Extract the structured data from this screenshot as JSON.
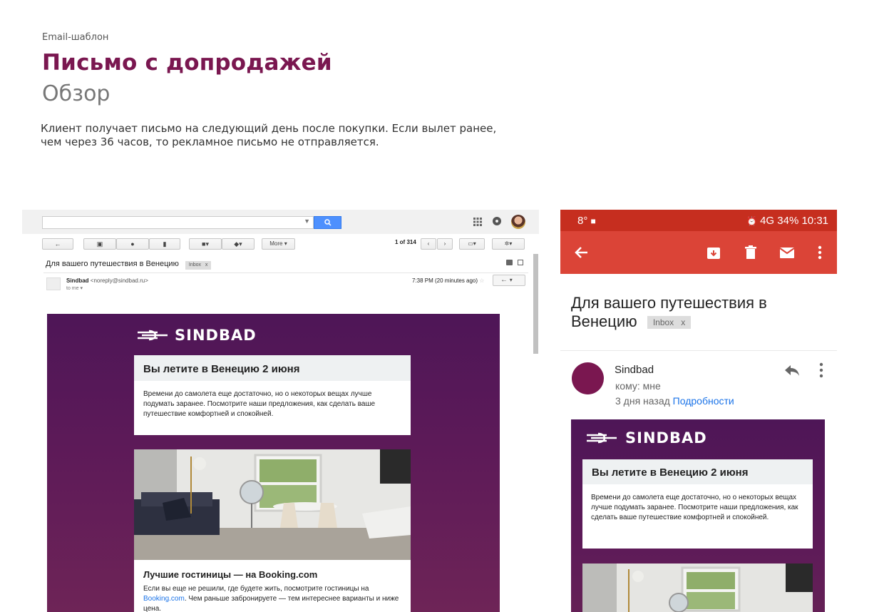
{
  "header": {
    "eyebrow": "Email-шаблон",
    "title": "Письмо с допродажей",
    "subtitle": "Обзор",
    "description": "Клиент получает письмо на следующий день после покупки. Если вылет ранее, чем через 36 часов, то рекламное письмо не отправляется."
  },
  "desktop": {
    "toolbar": {
      "more_label": "More",
      "pager": "1 of 314"
    },
    "subject": "Для вашего путешествия в Венецию",
    "tag": "Inbox",
    "tag_close": "x",
    "sender_name": "Sindbad",
    "sender_email": "<noreply@sindbad.ru>",
    "to_me": "to me",
    "time": "7:38 PM (20 minutes ago)"
  },
  "email": {
    "logo_text": "SINDBAD",
    "card1_title": "Вы летите в Венецию 2 июня",
    "card1_body": "Времени до самолета еще достаточно, но о некоторых вещах лучше подумать заранее. Посмотрите наши предложения, как сделать ваше путешествие комфортней и спокойней.",
    "card2_title": "Лучшие гостиницы — на Booking.com",
    "card2_body_before": "Если вы еще не решили, где будете жить, посмотрите гостиницы на",
    "card2_link": "Booking.com",
    "card2_body_after": ". Чем раньше забронируете — тем интереснее варианты и ниже цена."
  },
  "mobile": {
    "status_left": "8°",
    "status_right": "4G  34%  10:31",
    "subject": "Для вашего путешествия в Венецию",
    "tag": "Inbox",
    "tag_close": "x",
    "sender_name": "Sindbad",
    "to": "кому: мне",
    "when": "3 дня назад",
    "details_link": "Подробности"
  },
  "colors": {
    "brand": "#7a1750",
    "email_bg": "#5d1a58",
    "gmail_red": "#db4437",
    "search_blue": "#4d90fe"
  }
}
